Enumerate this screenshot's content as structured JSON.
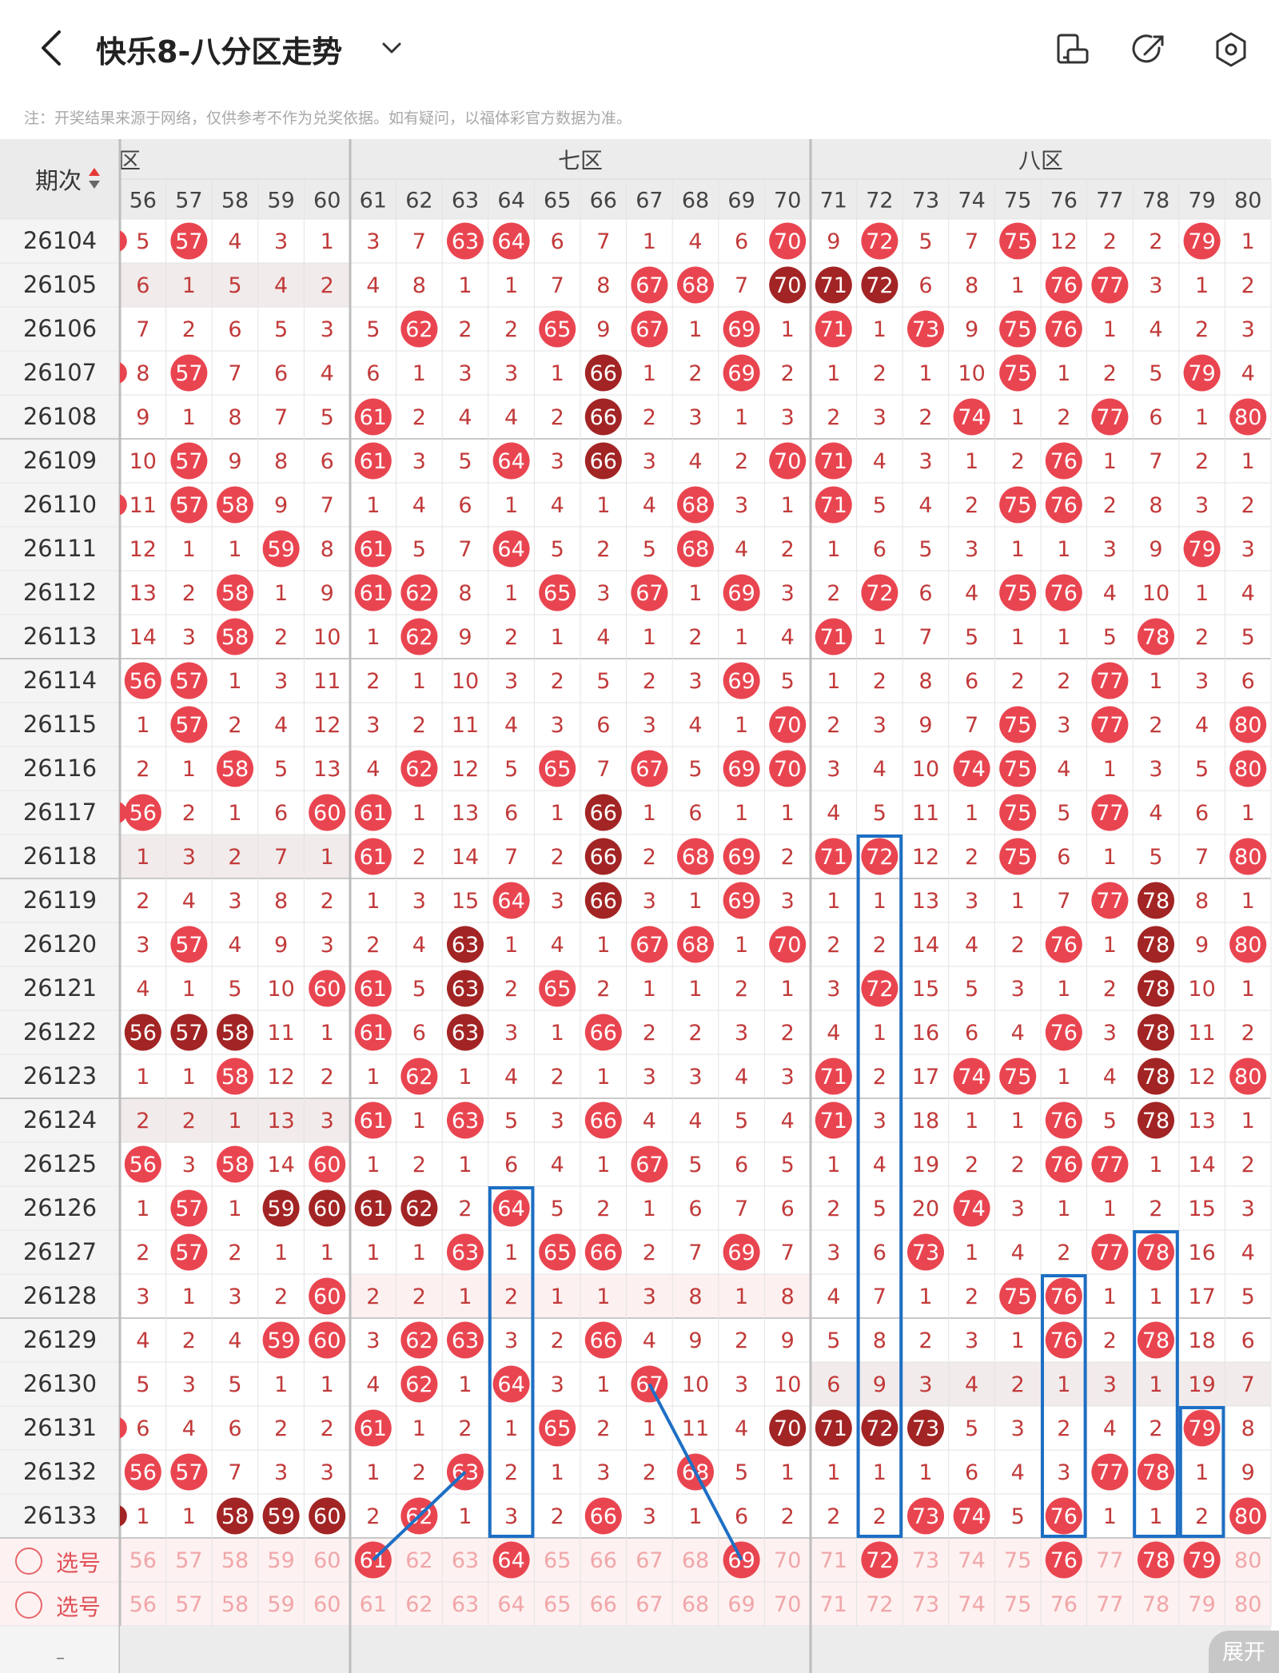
{
  "topbar": {
    "title": "快乐8-八分区走势",
    "back_icon": "chevron-left-icon",
    "dropdown_icon": "chevron-down-icon",
    "icons": [
      "tablet-rotate-icon",
      "share-arrow-icon",
      "settings-hexagon-icon"
    ]
  },
  "notice": "注：开奖结果来源于网络，仅供参考不作为兑奖依据。如有疑问，以福体彩官方数据为准。",
  "table": {
    "period_header": "期次",
    "zones": [
      {
        "label": "六区",
        "from": 56,
        "to": 60
      },
      {
        "label": "七区",
        "from": 61,
        "to": 70
      },
      {
        "label": "八区",
        "from": 71,
        "to": 80
      }
    ],
    "columns": [
      "56",
      "57",
      "58",
      "59",
      "60",
      "61",
      "62",
      "63",
      "64",
      "65",
      "66",
      "67",
      "68",
      "69",
      "70",
      "71",
      "72",
      "73",
      "74",
      "75",
      "76",
      "77",
      "78",
      "79",
      "80"
    ],
    "periods": [
      "26104",
      "26105",
      "26106",
      "26107",
      "26108",
      "26109",
      "26110",
      "26111",
      "26112",
      "26113",
      "26114",
      "26115",
      "26116",
      "26117",
      "26118",
      "26119",
      "26120",
      "26121",
      "26122",
      "26123",
      "26124",
      "26125",
      "26126",
      "26127",
      "26128",
      "26129",
      "26130",
      "26131",
      "26132",
      "26133"
    ],
    "rows": [
      [
        "5",
        "57",
        "4",
        "3",
        "1",
        "3",
        "7",
        "63",
        "64",
        "6",
        "7",
        "1",
        "4",
        "6",
        "70",
        "9",
        "72",
        "5",
        "7",
        "75",
        "12",
        "2",
        "2",
        "79",
        "1"
      ],
      [
        "6",
        "1",
        "5",
        "4",
        "2",
        "4",
        "8",
        "1",
        "1",
        "7",
        "8",
        "67",
        "68",
        "7",
        "70",
        "71",
        "72",
        "6",
        "8",
        "1",
        "76",
        "77",
        "3",
        "1",
        "2"
      ],
      [
        "7",
        "2",
        "6",
        "5",
        "3",
        "5",
        "62",
        "2",
        "2",
        "65",
        "9",
        "67",
        "1",
        "69",
        "1",
        "71",
        "1",
        "73",
        "9",
        "75",
        "76",
        "1",
        "4",
        "2",
        "3"
      ],
      [
        "8",
        "57",
        "7",
        "6",
        "4",
        "6",
        "1",
        "3",
        "3",
        "1",
        "66",
        "1",
        "2",
        "69",
        "2",
        "1",
        "2",
        "1",
        "10",
        "75",
        "1",
        "2",
        "5",
        "79",
        "4"
      ],
      [
        "9",
        "1",
        "8",
        "7",
        "5",
        "61",
        "2",
        "4",
        "4",
        "2",
        "66",
        "2",
        "3",
        "1",
        "3",
        "2",
        "3",
        "2",
        "74",
        "1",
        "2",
        "77",
        "6",
        "1",
        "80"
      ],
      [
        "10",
        "57",
        "9",
        "8",
        "6",
        "61",
        "3",
        "5",
        "64",
        "3",
        "66",
        "3",
        "4",
        "2",
        "70",
        "71",
        "4",
        "3",
        "1",
        "2",
        "76",
        "1",
        "7",
        "2",
        "1"
      ],
      [
        "11",
        "57",
        "58",
        "9",
        "7",
        "1",
        "4",
        "6",
        "1",
        "4",
        "1",
        "4",
        "68",
        "3",
        "1",
        "71",
        "5",
        "4",
        "2",
        "75",
        "76",
        "2",
        "8",
        "3",
        "2"
      ],
      [
        "12",
        "1",
        "1",
        "59",
        "8",
        "61",
        "5",
        "7",
        "64",
        "5",
        "2",
        "5",
        "68",
        "4",
        "2",
        "1",
        "6",
        "5",
        "3",
        "1",
        "1",
        "3",
        "9",
        "79",
        "3"
      ],
      [
        "13",
        "2",
        "58",
        "1",
        "9",
        "61",
        "62",
        "8",
        "1",
        "65",
        "3",
        "67",
        "1",
        "69",
        "3",
        "2",
        "72",
        "6",
        "4",
        "75",
        "76",
        "4",
        "10",
        "1",
        "4"
      ],
      [
        "14",
        "3",
        "58",
        "2",
        "10",
        "1",
        "62",
        "9",
        "2",
        "1",
        "4",
        "1",
        "2",
        "1",
        "4",
        "71",
        "1",
        "7",
        "5",
        "1",
        "1",
        "5",
        "78",
        "2",
        "5"
      ],
      [
        "56",
        "57",
        "1",
        "3",
        "11",
        "2",
        "1",
        "10",
        "3",
        "2",
        "5",
        "2",
        "3",
        "69",
        "5",
        "1",
        "2",
        "8",
        "6",
        "2",
        "2",
        "77",
        "1",
        "3",
        "6"
      ],
      [
        "1",
        "57",
        "2",
        "4",
        "12",
        "3",
        "2",
        "11",
        "4",
        "3",
        "6",
        "3",
        "4",
        "1",
        "70",
        "2",
        "3",
        "9",
        "7",
        "75",
        "3",
        "77",
        "2",
        "4",
        "80"
      ],
      [
        "2",
        "1",
        "58",
        "5",
        "13",
        "4",
        "62",
        "12",
        "5",
        "65",
        "7",
        "67",
        "5",
        "69",
        "70",
        "3",
        "4",
        "10",
        "74",
        "75",
        "4",
        "1",
        "3",
        "5",
        "80"
      ],
      [
        "56",
        "2",
        "1",
        "6",
        "60",
        "61",
        "1",
        "13",
        "6",
        "1",
        "66",
        "1",
        "6",
        "1",
        "1",
        "4",
        "5",
        "11",
        "1",
        "75",
        "5",
        "77",
        "4",
        "6",
        "1"
      ],
      [
        "1",
        "3",
        "2",
        "7",
        "1",
        "61",
        "2",
        "14",
        "7",
        "2",
        "66",
        "2",
        "68",
        "69",
        "2",
        "71",
        "72",
        "12",
        "2",
        "75",
        "6",
        "1",
        "5",
        "7",
        "80"
      ],
      [
        "2",
        "4",
        "3",
        "8",
        "2",
        "1",
        "3",
        "15",
        "64",
        "3",
        "66",
        "3",
        "1",
        "69",
        "3",
        "1",
        "1",
        "13",
        "3",
        "1",
        "7",
        "77",
        "78",
        "8",
        "1"
      ],
      [
        "3",
        "57",
        "4",
        "9",
        "3",
        "2",
        "4",
        "63",
        "1",
        "4",
        "1",
        "67",
        "68",
        "1",
        "70",
        "2",
        "2",
        "14",
        "4",
        "2",
        "76",
        "1",
        "78",
        "9",
        "80"
      ],
      [
        "4",
        "1",
        "5",
        "10",
        "60",
        "61",
        "5",
        "63",
        "2",
        "65",
        "2",
        "1",
        "1",
        "2",
        "1",
        "3",
        "72",
        "15",
        "5",
        "3",
        "1",
        "2",
        "78",
        "10",
        "1"
      ],
      [
        "56",
        "57",
        "58",
        "11",
        "1",
        "61",
        "6",
        "63",
        "3",
        "1",
        "66",
        "2",
        "2",
        "3",
        "2",
        "4",
        "1",
        "16",
        "6",
        "4",
        "76",
        "3",
        "78",
        "11",
        "2"
      ],
      [
        "1",
        "1",
        "58",
        "12",
        "2",
        "1",
        "62",
        "1",
        "4",
        "2",
        "1",
        "3",
        "3",
        "4",
        "3",
        "71",
        "2",
        "17",
        "74",
        "75",
        "1",
        "4",
        "78",
        "12",
        "80"
      ],
      [
        "2",
        "2",
        "1",
        "13",
        "3",
        "61",
        "1",
        "63",
        "5",
        "3",
        "66",
        "4",
        "4",
        "5",
        "4",
        "71",
        "3",
        "18",
        "1",
        "1",
        "76",
        "5",
        "78",
        "13",
        "1"
      ],
      [
        "56",
        "3",
        "58",
        "14",
        "60",
        "1",
        "2",
        "1",
        "6",
        "4",
        "1",
        "67",
        "5",
        "6",
        "5",
        "1",
        "4",
        "19",
        "2",
        "2",
        "76",
        "77",
        "1",
        "14",
        "2"
      ],
      [
        "1",
        "57",
        "1",
        "59",
        "60",
        "61",
        "62",
        "2",
        "64",
        "5",
        "2",
        "1",
        "6",
        "7",
        "6",
        "2",
        "5",
        "20",
        "74",
        "3",
        "1",
        "1",
        "2",
        "15",
        "3"
      ],
      [
        "2",
        "57",
        "2",
        "1",
        "1",
        "1",
        "1",
        "63",
        "1",
        "65",
        "66",
        "2",
        "7",
        "69",
        "7",
        "3",
        "6",
        "73",
        "1",
        "4",
        "2",
        "77",
        "78",
        "16",
        "4"
      ],
      [
        "3",
        "1",
        "3",
        "2",
        "60",
        "2",
        "2",
        "1",
        "2",
        "1",
        "1",
        "3",
        "8",
        "1",
        "8",
        "4",
        "7",
        "1",
        "2",
        "75",
        "76",
        "1",
        "1",
        "17",
        "5"
      ],
      [
        "4",
        "2",
        "4",
        "59",
        "60",
        "3",
        "62",
        "63",
        "3",
        "2",
        "66",
        "4",
        "9",
        "2",
        "9",
        "5",
        "8",
        "2",
        "3",
        "1",
        "76",
        "2",
        "78",
        "18",
        "6"
      ],
      [
        "5",
        "3",
        "5",
        "1",
        "1",
        "4",
        "62",
        "1",
        "64",
        "3",
        "1",
        "67",
        "10",
        "3",
        "10",
        "6",
        "9",
        "3",
        "4",
        "2",
        "1",
        "3",
        "1",
        "19",
        "7"
      ],
      [
        "6",
        "4",
        "6",
        "2",
        "2",
        "61",
        "1",
        "2",
        "1",
        "65",
        "2",
        "1",
        "11",
        "4",
        "70",
        "71",
        "72",
        "73",
        "5",
        "3",
        "2",
        "4",
        "2",
        "79",
        "8"
      ],
      [
        "56",
        "57",
        "7",
        "3",
        "3",
        "1",
        "2",
        "63",
        "2",
        "1",
        "3",
        "2",
        "68",
        "5",
        "1",
        "1",
        "1",
        "1",
        "6",
        "4",
        "3",
        "77",
        "78",
        "1",
        "9"
      ],
      [
        "1",
        "1",
        "58",
        "59",
        "60",
        "2",
        "62",
        "1",
        "3",
        "2",
        "66",
        "3",
        "1",
        "6",
        "2",
        "2",
        "2",
        "73",
        "74",
        "5",
        "76",
        "1",
        "1",
        "2",
        "80"
      ]
    ],
    "dark_cells": [
      [
        "26105",
        "70"
      ],
      [
        "26105",
        "71"
      ],
      [
        "26105",
        "72"
      ],
      [
        "26107",
        "66"
      ],
      [
        "26108",
        "66"
      ],
      [
        "26109",
        "66"
      ],
      [
        "26117",
        "66"
      ],
      [
        "26118",
        "66"
      ],
      [
        "26119",
        "66"
      ],
      [
        "26119",
        "78"
      ],
      [
        "26120",
        "63"
      ],
      [
        "26120",
        "78"
      ],
      [
        "26121",
        "63"
      ],
      [
        "26121",
        "78"
      ],
      [
        "26122",
        "56"
      ],
      [
        "26122",
        "57"
      ],
      [
        "26122",
        "58"
      ],
      [
        "26122",
        "63"
      ],
      [
        "26122",
        "78"
      ],
      [
        "26123",
        "78"
      ],
      [
        "26124",
        "78"
      ],
      [
        "26126",
        "59"
      ],
      [
        "26126",
        "60"
      ],
      [
        "26126",
        "61"
      ],
      [
        "26126",
        "62"
      ],
      [
        "26131",
        "70"
      ],
      [
        "26131",
        "71"
      ],
      [
        "26131",
        "72"
      ],
      [
        "26131",
        "73"
      ],
      [
        "26133",
        "58"
      ],
      [
        "26133",
        "59"
      ],
      [
        "26133",
        "60"
      ]
    ],
    "select_row_1": {
      "label": "选号",
      "picked": [
        "61",
        "64",
        "69",
        "72",
        "76",
        "78",
        "79"
      ]
    },
    "select_row_2": {
      "label": "选号",
      "picked": []
    }
  },
  "bottom": {
    "expand_label": "展开",
    "period_stub": "–"
  },
  "colors": {
    "red_ball": "#e94550",
    "dark_ball": "#a22424",
    "miss_text": "#c23a3a",
    "annotation_blue": "#1d6fc4",
    "header_bg": "#ececec"
  }
}
